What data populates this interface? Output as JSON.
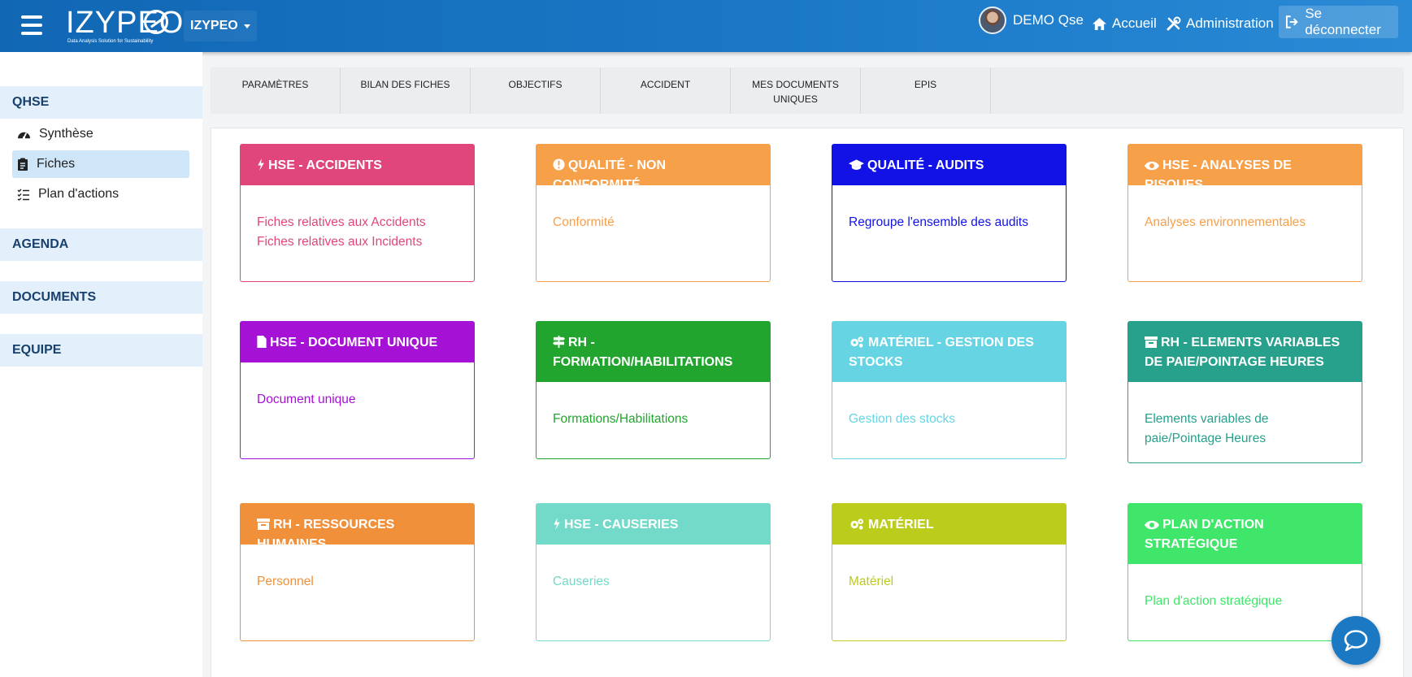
{
  "header": {
    "logo_text": "IZYPEO",
    "logo_tagline": "Data Analysis Solution for Sustainability",
    "app_switcher": "IZYPEO",
    "user_name": "DEMO Qse",
    "home_label": "Accueil",
    "admin_label": "Administration",
    "logout_label": "Se déconnecter"
  },
  "sidebar": {
    "qhse": "QHSE",
    "items": [
      {
        "label": "Synthèse",
        "icon": "gauge-icon"
      },
      {
        "label": "Fiches",
        "icon": "clipboard-icon",
        "active": true
      },
      {
        "label": "Plan d'actions",
        "icon": "tasks-icon"
      }
    ],
    "agenda": "AGENDA",
    "documents": "DOCUMENTS",
    "equipe": "EQUIPE"
  },
  "tabs": [
    "PARAMÈTRES",
    "BILAN DES FICHES",
    "OBJECTIFS",
    "ACCIDENT",
    "MES DOCUMENTS UNIQUES",
    "EPIS"
  ],
  "cards": [
    {
      "title": "HSE - ACCIDENTS",
      "icon": "bolt-icon",
      "color": "#e0467c",
      "lines": [
        "Fiches relatives aux Accidents",
        "Fiches relatives aux Incidents"
      ]
    },
    {
      "title": "QUALITÉ - NON CONFORMITÉ",
      "icon": "exclamation-circle-icon",
      "color": "#f7a04a",
      "lines": [
        "Conformité"
      ]
    },
    {
      "title": "QUALITÉ - AUDITS",
      "icon": "graduation-cap-icon",
      "color": "#1212e6",
      "lines": [
        "Regroupe l'ensemble des audits"
      ]
    },
    {
      "title": "HSE - ANALYSES DE RISQUES",
      "icon": "eye-icon",
      "color": "#f7a04a",
      "lines": [
        "Analyses environnementales"
      ]
    },
    {
      "title": "HSE - DOCUMENT UNIQUE",
      "icon": "file-icon",
      "color": "#a611d6",
      "lines": [
        "Document unique"
      ]
    },
    {
      "title": "RH - FORMATION/HABILITATIONS",
      "icon": "signpost-icon",
      "color": "#22a52e",
      "lines": [
        "Formations/Habilitations"
      ]
    },
    {
      "title": "MATÉRIEL - GESTION DES STOCKS",
      "icon": "cogs-icon",
      "color": "#66d4e2",
      "lines": [
        "Gestion des stocks"
      ]
    },
    {
      "title": "RH - ELEMENTS VARIABLES DE PAIE/POINTAGE HEURES",
      "icon": "archive-icon",
      "color": "#27a08c",
      "lines": [
        "Elements variables de paie/Pointage Heures"
      ]
    },
    {
      "title": "RH - RESSOURCES HUMAINES",
      "icon": "archive-icon",
      "color": "#f0903a",
      "lines": [
        "Personnel"
      ]
    },
    {
      "title": "HSE - CAUSERIES",
      "icon": "bolt-icon",
      "color": "#73d9c8",
      "lines": [
        "Causeries"
      ]
    },
    {
      "title": "MATÉRIEL",
      "icon": "cogs-icon",
      "color": "#bccc1c",
      "lines": [
        "Matériel"
      ]
    },
    {
      "title": "PLAN D'ACTION STRATÉGIQUE",
      "icon": "eye-icon",
      "color": "#3fe66a",
      "lines": [
        "Plan d'action stratégique"
      ]
    }
  ]
}
